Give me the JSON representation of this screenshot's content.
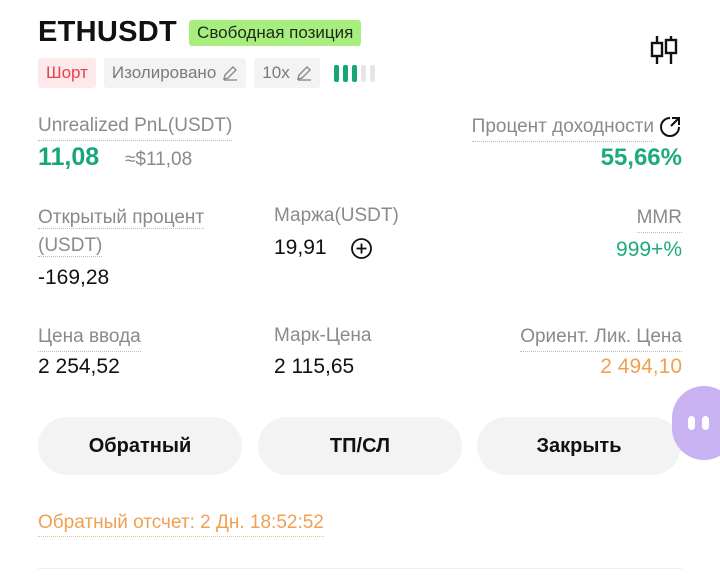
{
  "header": {
    "symbol": "ETHUSDT",
    "badge": "Свободная позиция"
  },
  "tags": {
    "side": "Шорт",
    "margin_mode": "Изолировано",
    "leverage": "10x",
    "leverage_level_bars": 3,
    "leverage_total_bars": 5
  },
  "pnl": {
    "label": "Unrealized PnL(USDT)",
    "value": "11,08",
    "usd_approx": "≈$11,08"
  },
  "roi": {
    "label": "Процент доходности",
    "value": "55,66%"
  },
  "open_interest": {
    "label_line1": "Открытый процент",
    "label_line2": "(USDT)",
    "value": "-169,28"
  },
  "margin": {
    "label": "Маржа(USDT)",
    "value": "19,91"
  },
  "mmr": {
    "label": "MMR",
    "value": "999+%"
  },
  "entry": {
    "label": "Цена ввода",
    "value": "2 254,52"
  },
  "mark": {
    "label": "Марк-Цена",
    "value": "2 115,65"
  },
  "liq": {
    "label": "Ориент. Лик. Цена",
    "value": "2 494,10"
  },
  "actions": {
    "reverse": "Обратный",
    "tpsl": "ТП/СЛ",
    "close": "Закрыть"
  },
  "countdown": {
    "label": "Обратный отсчет:",
    "value": "2 Дн. 18:52:52"
  },
  "colors": {
    "green": "#17a57a",
    "short_red": "#e8414f",
    "orange": "#f0a052",
    "badge_green": "#a7ee7f"
  }
}
